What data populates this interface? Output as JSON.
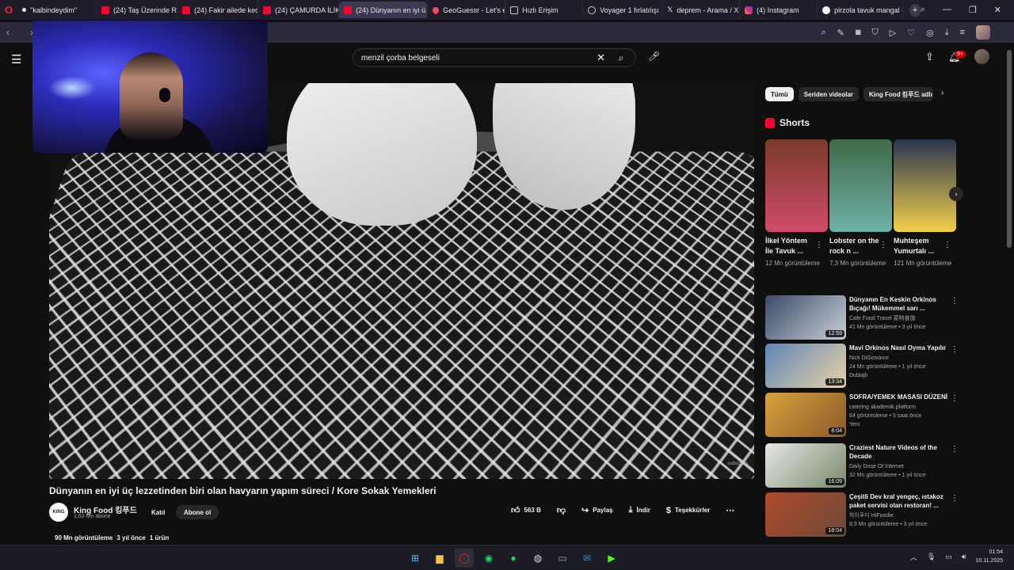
{
  "browser": {
    "tabs": [
      {
        "label": "\"kalbindeydim\"",
        "icon": "dot",
        "active": false
      },
      {
        "label": "(24) Taş Üzerinde Rulo",
        "icon": "yt",
        "active": false
      },
      {
        "label": "(24) Fakir ailede kedi d",
        "icon": "yt",
        "active": false
      },
      {
        "label": "(24) ÇAMURDA İLİKLİ",
        "icon": "yt",
        "active": false
      },
      {
        "label": "(24) Dünyanın en iyi ü",
        "icon": "yt",
        "active": true
      },
      {
        "label": "GeoGuessr - Let's expl",
        "icon": "geo",
        "active": false
      },
      {
        "label": "Hızlı Erişim",
        "icon": "grid",
        "active": false
      },
      {
        "label": "Voyager 1 fırlatılışı",
        "icon": "globe",
        "active": false
      },
      {
        "label": "deprem - Arama / X",
        "icon": "x",
        "active": false
      },
      {
        "label": "(4) Instagram",
        "icon": "ig",
        "active": false
      },
      {
        "label": "pirzola tavuk mangal -",
        "icon": "g",
        "active": false
      }
    ],
    "new_tab_glyph": "+"
  },
  "youtube": {
    "search": {
      "value": "menzil çorba belgeseli"
    },
    "notifications_badge": "9+"
  },
  "video": {
    "title": "Dünyanın en iyi üç lezzetinden biri olan havyarın yapım süreci / Kore Sokak Yemekleri",
    "watermark": "subscribe",
    "channel": {
      "name": "King Food 킹푸드",
      "subs": "1,63 Mn abone",
      "avatar_text": "KING"
    },
    "join_label": "Katıl",
    "subscribe_label": "Abone ol",
    "likes": "563 B",
    "share_label": "Paylaş",
    "download_label": "İndir",
    "thanks_label": "Teşekkürler",
    "views": "90 Mn görüntüleme",
    "age": "3 yıl önce",
    "products": "1 ürün"
  },
  "chips": [
    "Tümü",
    "Seriden videolar",
    "King Food 킹푸드 adlı"
  ],
  "shorts": {
    "heading": "Shorts",
    "items": [
      {
        "title": "İlkel Yöntem İle Tavuk ...",
        "views": "12 Mn görüntüleme",
        "color1": "#7a3b2a",
        "color2": "#d14a6a"
      },
      {
        "title": "Lobster on the rock n ...",
        "views": "7,3 Mn görüntüleme",
        "color1": "#3f6b4a",
        "color2": "#6fb0a8"
      },
      {
        "title": "Muhteşem Yumurtalı ...",
        "views": "121 Mn görüntüleme",
        "color1": "#2a3550",
        "color2": "#f2d04a"
      }
    ]
  },
  "recommendations": [
    {
      "title": "Dünyanın En Keskin Orkinos Bıçağı! Mükemmel sarı ...",
      "channel": "Cafe Food Travel 菜特食旅",
      "meta": "41 Mn görüntüleme • 3 yıl önce",
      "duration": "12:59",
      "badge": "",
      "color1": "#3b4a66",
      "color2": "#c9cfd8"
    },
    {
      "title": "Mavi Orkinos Nasıl Oyma Yapılır",
      "channel": "Nick DiGiovanni",
      "meta": "24 Mn görüntüleme • 1 yıl önce",
      "duration": "13:34",
      "badge": "Dublajlı",
      "color1": "#5f86b5",
      "color2": "#e8d2a6"
    },
    {
      "title": "SOFRA/YEMEK MASASI DÜZENİ",
      "channel": "catering akademik platform",
      "meta": "64 görüntüleme • 5 saat önce",
      "duration": "8:04",
      "badge": "Yeni",
      "color1": "#d9a23c",
      "color2": "#8a5a2a"
    },
    {
      "title": "Craziest Nature Videos of the Decade",
      "channel": "Daily Dose Of Internet",
      "meta": "32 Mn görüntüleme • 1 yıl önce",
      "duration": "16:09",
      "badge": "",
      "color1": "#e6e6e6",
      "color2": "#7a8a6a"
    },
    {
      "title": "Çeşitli Dev kral yengeç, ıstakoz paket servisi olan restoran! ...",
      "channel": "하이푸디 HiFoodie",
      "meta": "8,9 Mn görüntüleme • 3 yıl önce",
      "duration": "18:04",
      "badge": "",
      "color1": "#b04a2a",
      "color2": "#6a4a3a"
    }
  ],
  "taskbar": {
    "time": "01:54",
    "date": "10.11.2025"
  }
}
